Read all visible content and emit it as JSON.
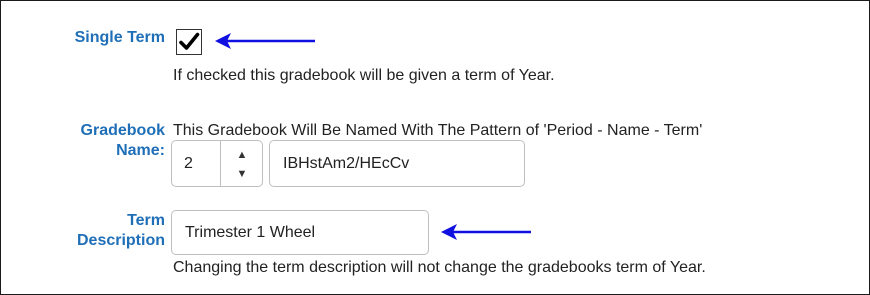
{
  "single_term": {
    "label": "Single Term",
    "checked": true,
    "hint": "If checked this gradebook will be given a term of Year."
  },
  "gradebook_name": {
    "label_line1": "Gradebook",
    "label_line2": "Name:",
    "hint": "This Gradebook Will Be Named With The Pattern of 'Period - Name - Term'",
    "period_value": "2",
    "name_value": "IBHstAm2/HEcCv",
    "spin_up": "▲",
    "spin_down": "▼"
  },
  "term_description": {
    "label_line1": "Term",
    "label_line2": "Description",
    "value": "Trimester 1 Wheel",
    "hint": "Changing the term description will not change the gradebooks term of Year."
  },
  "colors": {
    "label": "#1f6fb8",
    "arrow": "#1010e0",
    "text": "#222222",
    "input_border": "#bfbfbf"
  },
  "icons": [
    "checkmark-icon",
    "arrow-left-icon",
    "spin-up-icon",
    "spin-down-icon"
  ]
}
